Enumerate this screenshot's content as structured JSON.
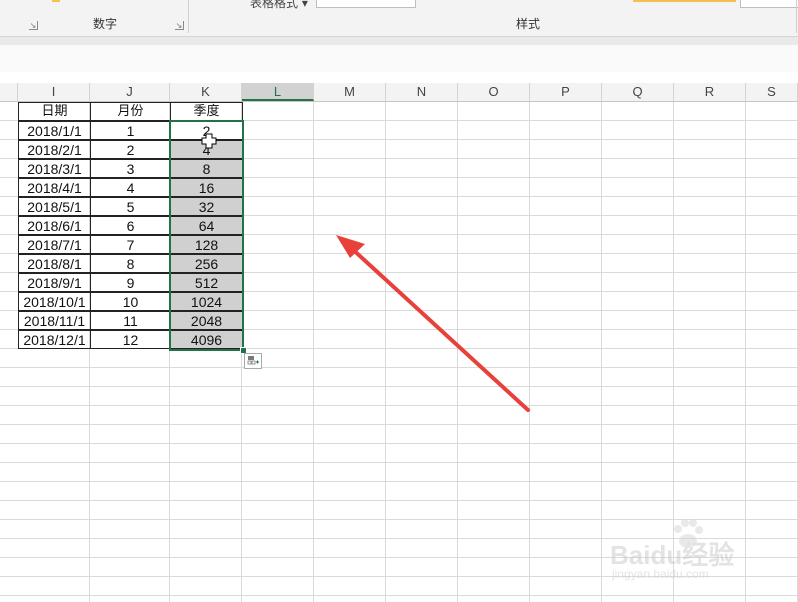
{
  "ribbon": {
    "group_number_label": "数字",
    "group_style_label": "样式",
    "table_format_label": "表格格式"
  },
  "columns": [
    "I",
    "J",
    "K",
    "L",
    "M",
    "N",
    "O",
    "P",
    "Q",
    "R",
    "S"
  ],
  "selected_column": "L",
  "table": {
    "headers": [
      "日期",
      "月份",
      "季度"
    ],
    "rows": [
      [
        "2018/1/1",
        "1",
        "2"
      ],
      [
        "2018/2/1",
        "2",
        "4"
      ],
      [
        "2018/3/1",
        "3",
        "8"
      ],
      [
        "2018/4/1",
        "4",
        "16"
      ],
      [
        "2018/5/1",
        "5",
        "32"
      ],
      [
        "2018/6/1",
        "6",
        "64"
      ],
      [
        "2018/7/1",
        "7",
        "128"
      ],
      [
        "2018/8/1",
        "8",
        "256"
      ],
      [
        "2018/9/1",
        "9",
        "512"
      ],
      [
        "2018/10/1",
        "10",
        "1024"
      ],
      [
        "2018/11/1",
        "11",
        "2048"
      ],
      [
        "2018/12/1",
        "12",
        "4096"
      ]
    ]
  },
  "annotation": {
    "arrow_color": "#e8403a"
  },
  "watermark": {
    "main": "Baidu经验",
    "sub": "jingyan.baidu.com"
  },
  "colors": {
    "accent": "#217346",
    "selection_fill": "#d0d0d0"
  }
}
